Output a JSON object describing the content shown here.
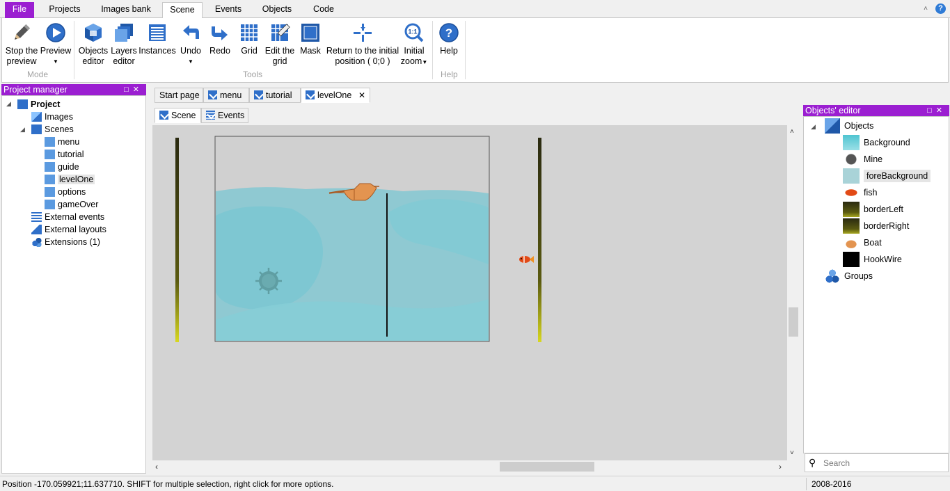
{
  "ribbon_tabs": [
    "File",
    "Projects",
    "Images bank",
    "Scene",
    "Events",
    "Objects",
    "Code"
  ],
  "ribbon": {
    "stop_preview": "Stop the\npreview",
    "preview": "Preview",
    "group_mode": "Mode",
    "objects_editor": "Objects\neditor",
    "layers_editor": "Layers\neditor",
    "instances": "Instances",
    "undo": "Undo",
    "redo": "Redo",
    "grid": "Grid",
    "edit_grid": "Edit the\ngrid",
    "mask": "Mask",
    "return_initial": "Return to the initial\nposition ( 0;0 )",
    "initial_zoom": "Initial\nzoom",
    "group_tools": "Tools",
    "help": "Help",
    "group_help": "Help"
  },
  "project_panel": {
    "title": "Project manager",
    "root": "Project",
    "images": "Images",
    "scenes": "Scenes",
    "scene_list": [
      "menu",
      "tutorial",
      "guide",
      "levelOne",
      "options",
      "gameOver"
    ],
    "selected_scene": "levelOne",
    "external_events": "External events",
    "external_layouts": "External layouts",
    "extensions": "Extensions (1)"
  },
  "doc_tabs": [
    "Start page",
    "menu",
    "tutorial",
    "levelOne"
  ],
  "sub_tabs": [
    "Scene",
    "Events"
  ],
  "objects_panel": {
    "title": "Objects' editor",
    "objects_label": "Objects",
    "objects": [
      "Background",
      "Mine",
      "foreBackground",
      "fish",
      "borderLeft",
      "borderRight",
      "Boat",
      "HookWire"
    ],
    "selected": "foreBackground",
    "groups_label": "Groups",
    "search_placeholder": "Search"
  },
  "status": {
    "left": "Position -170.059921;11.637710. SHIFT for multiple selection, right click for more options.",
    "right": "2008-2016"
  },
  "colors": {
    "accent": "#9b1fd1",
    "water": "#7fc6cf",
    "canvas": "#d3d3d3",
    "boat": "#e39450"
  }
}
